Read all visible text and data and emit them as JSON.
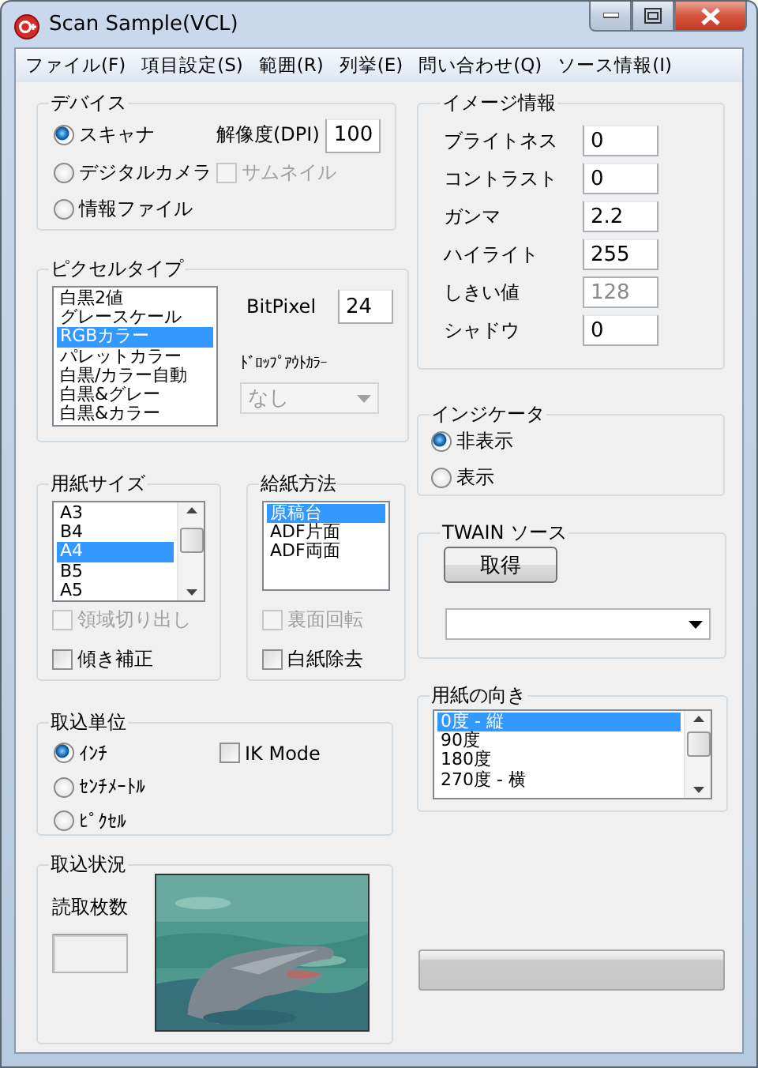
{
  "window": {
    "title": "Scan Sample(VCL)"
  },
  "menu": [
    {
      "label": "ファイル(F)"
    },
    {
      "label": "項目設定(S)"
    },
    {
      "label": "範囲(R)"
    },
    {
      "label": "列挙(E)"
    },
    {
      "label": "問い合わせ(Q)"
    },
    {
      "label": "ソース情報(I)"
    }
  ],
  "device": {
    "title": "デバイス",
    "options": [
      {
        "label": "スキャナ",
        "selected": true
      },
      {
        "label": "デジタルカメラ",
        "selected": false
      },
      {
        "label": "情報ファイル",
        "selected": false
      }
    ],
    "resolution_label": "解像度(DPI)",
    "resolution": "100",
    "thumbnail": {
      "label": "サムネイル",
      "checked": false,
      "disabled": true
    }
  },
  "pixel_type": {
    "title": "ピクセルタイプ",
    "items": [
      {
        "label": "白黒2値",
        "selected": false
      },
      {
        "label": "グレースケール",
        "selected": false
      },
      {
        "label": "RGBカラー",
        "selected": true
      },
      {
        "label": "パレットカラー",
        "selected": false
      },
      {
        "label": "白黒/カラー自動",
        "selected": false
      },
      {
        "label": "白黒&グレー",
        "selected": false
      },
      {
        "label": "白黒&カラー",
        "selected": false
      }
    ],
    "bitpixel_label": "BitPixel",
    "bitpixel": "24",
    "dropout_label": "ﾄﾞﾛｯﾌﾟｱｳﾄｶﾗｰ",
    "dropout": {
      "value": "なし",
      "disabled": true
    }
  },
  "paper_size": {
    "title": "用紙サイズ",
    "items": [
      {
        "label": "A3",
        "selected": false
      },
      {
        "label": "B4",
        "selected": false
      },
      {
        "label": "A4",
        "selected": true
      },
      {
        "label": "B5",
        "selected": false
      },
      {
        "label": "A5",
        "selected": false
      }
    ],
    "crop": {
      "label": "領域切り出し",
      "checked": false,
      "disabled": true
    },
    "deskew": {
      "label": "傾き補正",
      "checked": false,
      "disabled": false
    }
  },
  "feed": {
    "title": "給紙方法",
    "items": [
      {
        "label": "原稿台",
        "selected": true
      },
      {
        "label": "ADF片面",
        "selected": false
      },
      {
        "label": "ADF両面",
        "selected": false
      }
    ],
    "back_rotate": {
      "label": "裏面回転",
      "checked": false,
      "disabled": true
    },
    "blank_removal": {
      "label": "白紙除去",
      "checked": false,
      "disabled": false
    }
  },
  "unit": {
    "title": "取込単位",
    "options": [
      {
        "label": "ｲﾝﾁ",
        "selected": true
      },
      {
        "label": "ｾﾝﾁﾒｰﾄﾙ",
        "selected": false
      },
      {
        "label": "ﾋﾟｸｾﾙ",
        "selected": false
      }
    ],
    "ik_mode": {
      "label": "IK Mode",
      "checked": false,
      "disabled": false
    }
  },
  "status": {
    "title": "取込状況",
    "count_label": "読取枚数"
  },
  "image_info": {
    "title": "イメージ情報",
    "fields": [
      {
        "label": "ブライトネス",
        "value": "0",
        "disabled": false
      },
      {
        "label": "コントラスト",
        "value": "0",
        "disabled": false
      },
      {
        "label": "ガンマ",
        "value": "2.2",
        "disabled": false
      },
      {
        "label": "ハイライト",
        "value": "255",
        "disabled": false
      },
      {
        "label": "しきい値",
        "value": "128",
        "disabled": true
      },
      {
        "label": "シャドウ",
        "value": "0",
        "disabled": false
      }
    ]
  },
  "indicator": {
    "title": "インジケータ",
    "options": [
      {
        "label": "非表示",
        "selected": true
      },
      {
        "label": "表示",
        "selected": false
      }
    ]
  },
  "twain": {
    "title": "TWAIN ソース",
    "button": "取得"
  },
  "orientation": {
    "title": "用紙の向き",
    "items": [
      {
        "label": "0度 - 縦",
        "selected": true
      },
      {
        "label": "90度",
        "selected": false
      },
      {
        "label": "180度",
        "selected": false
      },
      {
        "label": "270度 - 横",
        "selected": false
      }
    ]
  },
  "progress": {
    "level": 0
  }
}
